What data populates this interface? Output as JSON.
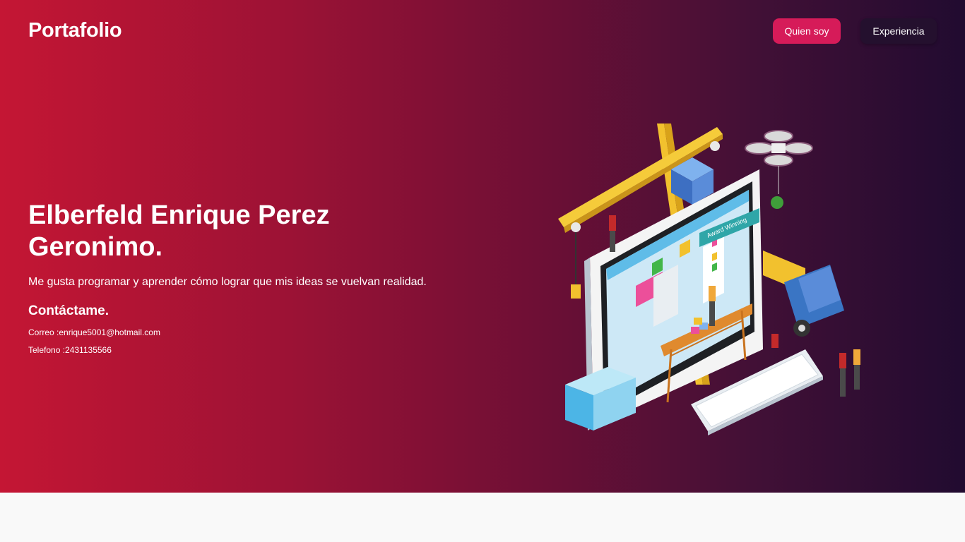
{
  "header": {
    "logo": "Portafolio",
    "nav": [
      {
        "label": "Quien soy"
      },
      {
        "label": "Experiencia"
      }
    ]
  },
  "hero": {
    "name": "Elberfeld Enrique Perez Geronimo.",
    "tagline": "Me gusta programar y aprender cómo lograr que mis ideas se vuelvan realidad.",
    "contact_title": "Contáctame.",
    "email_line": "Correo :enrique5001@hotmail.com",
    "phone_line": "Telefono :2431135566",
    "illustration_sign": "Award Winning",
    "illustration_icon": "website-construction-illustration"
  },
  "colors": {
    "gradient_start": "#c41634",
    "gradient_end": "#210b30",
    "primary_button": "#d61b59",
    "secondary_button": "#24102e",
    "footer_strip": "#f9f9f9"
  }
}
